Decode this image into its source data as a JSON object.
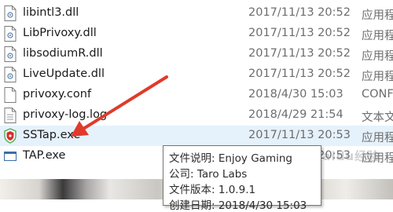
{
  "files": [
    {
      "name": "libintl3.dll",
      "date": "2017/11/13 20:52",
      "type": "应用程",
      "icon": "dll-file-icon"
    },
    {
      "name": "LibPrivoxy.dll",
      "date": "2017/11/13 20:52",
      "type": "应用程",
      "icon": "dll-file-icon"
    },
    {
      "name": "libsodiumR.dll",
      "date": "2017/11/13 20:52",
      "type": "应用程",
      "icon": "dll-file-icon"
    },
    {
      "name": "LiveUpdate.dll",
      "date": "2017/11/13 20:52",
      "type": "应用程",
      "icon": "dll-file-icon"
    },
    {
      "name": "privoxy.conf",
      "date": "2018/4/30 15:03",
      "type": "CONF",
      "icon": "text-file-icon"
    },
    {
      "name": "privoxy-log.log",
      "date": "2018/4/29 21:54",
      "type": "文本文",
      "icon": "text-file-icon"
    },
    {
      "name": "SSTap.exe",
      "date": "2017/11/13 20:53",
      "type": "应用程",
      "icon": "sstap-shield-icon"
    },
    {
      "name": "TAP.exe",
      "date": "2017/11/13 20:53",
      "type": "应用程",
      "icon": "exe-window-icon"
    }
  ],
  "tooltip": {
    "description": "文件说明: Enjoy Gaming",
    "company": "公司: Taro Labs",
    "version": "文件版本: 1.0.9.1",
    "created": "创建日期: 2018/4/30 15:03"
  },
  "watermark": "Baidu经验",
  "colors": {
    "selected_row": "#e5f1fb",
    "arrow": "#e03a2b",
    "shield_red": "#d32f2f",
    "shield_green": "#4caf50"
  }
}
